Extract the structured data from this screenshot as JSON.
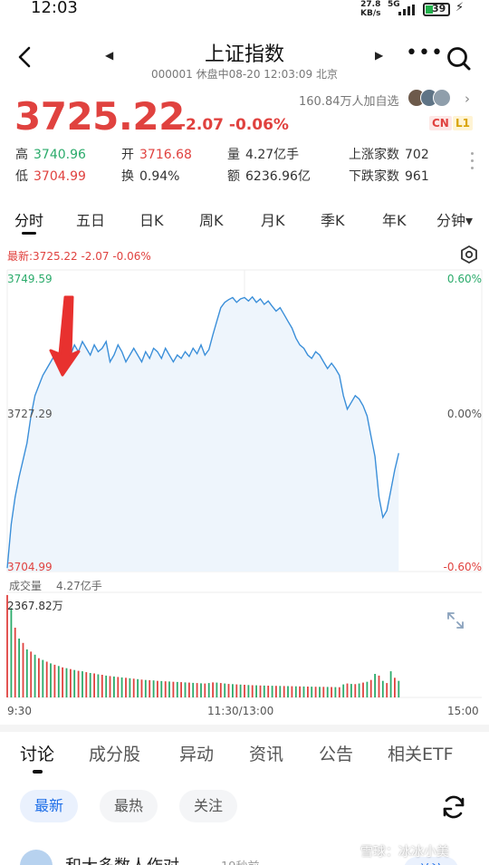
{
  "status_bar": {
    "time": "12:03",
    "net_speed": "27.8",
    "net_unit": "KB/s",
    "signal": "5G",
    "battery": "39"
  },
  "header": {
    "title": "上证指数",
    "subtitle": "000001 休盘中08-20 12:03:09 北京"
  },
  "quote": {
    "price": "3725.22",
    "change": "-2.07 -0.06%",
    "watchers": "160.84万人加自选",
    "tag_cn": "CN",
    "tag_l1": "L1",
    "stats": {
      "high_label": "高",
      "high": "3740.96",
      "open_label": "开",
      "open": "3716.68",
      "vol_label": "量",
      "vol": "4.27亿手",
      "rise_label": "上涨家数",
      "rise": "702",
      "low_label": "低",
      "low": "3704.99",
      "turn_label": "换",
      "turn": "0.94%",
      "amt_label": "额",
      "amt": "6236.96亿",
      "fall_label": "下跌家数",
      "fall": "961"
    }
  },
  "period_tabs": [
    "分时",
    "五日",
    "日K",
    "周K",
    "月K",
    "季K",
    "年K",
    "分钟▾"
  ],
  "chart_header": {
    "latest": "最新:3725.22  -2.07  -0.06%"
  },
  "chart_data": {
    "type": "line",
    "price_axis": {
      "max": "3749.59",
      "mid": "3727.29",
      "min": "3704.99"
    },
    "pct_axis": {
      "max": "0.60%",
      "mid": "0.00%",
      "min": "-0.60%"
    },
    "ylim": [
      3704.99,
      3749.59
    ],
    "prev_close": 3727.29,
    "x_range_minutes": 240,
    "price_series": [
      [
        0,
        3705.5
      ],
      [
        2,
        3712
      ],
      [
        4,
        3716
      ],
      [
        6,
        3719
      ],
      [
        8,
        3721.5
      ],
      [
        10,
        3724
      ],
      [
        12,
        3728
      ],
      [
        14,
        3731
      ],
      [
        16,
        3732.5
      ],
      [
        18,
        3734
      ],
      [
        20,
        3735
      ],
      [
        22,
        3736
      ],
      [
        24,
        3737
      ],
      [
        26,
        3736.5
      ],
      [
        28,
        3737.5
      ],
      [
        30,
        3738
      ],
      [
        32,
        3737
      ],
      [
        34,
        3738.5
      ],
      [
        36,
        3737.5
      ],
      [
        38,
        3739
      ],
      [
        40,
        3738
      ],
      [
        42,
        3737
      ],
      [
        44,
        3738.5
      ],
      [
        46,
        3737.5
      ],
      [
        48,
        3738
      ],
      [
        50,
        3739
      ],
      [
        52,
        3736
      ],
      [
        54,
        3737
      ],
      [
        56,
        3738.5
      ],
      [
        58,
        3737.5
      ],
      [
        60,
        3736
      ],
      [
        62,
        3737
      ],
      [
        64,
        3738
      ],
      [
        66,
        3737
      ],
      [
        68,
        3736
      ],
      [
        70,
        3737.5
      ],
      [
        72,
        3736.5
      ],
      [
        74,
        3738
      ],
      [
        76,
        3737.5
      ],
      [
        78,
        3736.5
      ],
      [
        80,
        3738
      ],
      [
        82,
        3737
      ],
      [
        84,
        3736
      ],
      [
        86,
        3737
      ],
      [
        88,
        3736.5
      ],
      [
        90,
        3737.5
      ],
      [
        92,
        3736.8
      ],
      [
        94,
        3738
      ],
      [
        96,
        3737.2
      ],
      [
        98,
        3738.5
      ],
      [
        100,
        3737
      ],
      [
        102,
        3737.8
      ],
      [
        104,
        3740
      ],
      [
        106,
        3742
      ],
      [
        108,
        3744
      ],
      [
        110,
        3744.8
      ],
      [
        112,
        3745.2
      ],
      [
        114,
        3745.5
      ],
      [
        116,
        3744.8
      ],
      [
        118,
        3745.3
      ],
      [
        120,
        3745.5
      ],
      [
        122,
        3745
      ],
      [
        124,
        3745.6
      ],
      [
        126,
        3744.8
      ],
      [
        128,
        3745.3
      ],
      [
        130,
        3744.5
      ],
      [
        132,
        3745
      ],
      [
        134,
        3744.2
      ],
      [
        136,
        3743.5
      ],
      [
        138,
        3744
      ],
      [
        140,
        3743
      ],
      [
        142,
        3742
      ],
      [
        144,
        3741
      ],
      [
        146,
        3739.5
      ],
      [
        148,
        3738.5
      ],
      [
        150,
        3738
      ],
      [
        152,
        3737
      ],
      [
        154,
        3736.5
      ],
      [
        156,
        3737.5
      ],
      [
        158,
        3737
      ],
      [
        160,
        3736
      ],
      [
        162,
        3735
      ],
      [
        164,
        3735.8
      ],
      [
        166,
        3735
      ],
      [
        168,
        3734
      ],
      [
        170,
        3731
      ],
      [
        172,
        3729
      ],
      [
        174,
        3730
      ],
      [
        176,
        3731
      ],
      [
        178,
        3730.5
      ],
      [
        180,
        3729.5
      ],
      [
        182,
        3728
      ],
      [
        184,
        3725
      ],
      [
        186,
        3722
      ],
      [
        188,
        3716
      ],
      [
        190,
        3713
      ],
      [
        192,
        3714
      ],
      [
        194,
        3717
      ],
      [
        196,
        3720
      ],
      [
        198,
        3722.5
      ]
    ],
    "volume_axis": {
      "label": "成交量",
      "total": "4.27亿手",
      "max_label": "2367.82万"
    },
    "volume_max": 2367.82,
    "volume_colors": {
      "up": "#e0423f",
      "down": "#2bab6b"
    },
    "volume_series": [
      [
        0,
        2350,
        "r"
      ],
      [
        2,
        2050,
        "g"
      ],
      [
        4,
        1600,
        "r"
      ],
      [
        6,
        1350,
        "g"
      ],
      [
        8,
        1250,
        "r"
      ],
      [
        10,
        1100,
        "g"
      ],
      [
        12,
        1050,
        "r"
      ],
      [
        14,
        980,
        "g"
      ],
      [
        16,
        900,
        "r"
      ],
      [
        18,
        860,
        "g"
      ],
      [
        20,
        820,
        "r"
      ],
      [
        22,
        780,
        "g"
      ],
      [
        24,
        750,
        "r"
      ],
      [
        26,
        720,
        "g"
      ],
      [
        28,
        690,
        "r"
      ],
      [
        30,
        670,
        "g"
      ],
      [
        32,
        650,
        "r"
      ],
      [
        34,
        630,
        "g"
      ],
      [
        36,
        610,
        "r"
      ],
      [
        38,
        600,
        "g"
      ],
      [
        40,
        580,
        "r"
      ],
      [
        42,
        560,
        "g"
      ],
      [
        44,
        550,
        "r"
      ],
      [
        46,
        530,
        "g"
      ],
      [
        48,
        520,
        "r"
      ],
      [
        50,
        500,
        "g"
      ],
      [
        52,
        490,
        "r"
      ],
      [
        54,
        480,
        "g"
      ],
      [
        56,
        470,
        "r"
      ],
      [
        58,
        460,
        "g"
      ],
      [
        60,
        450,
        "r"
      ],
      [
        62,
        440,
        "g"
      ],
      [
        64,
        430,
        "r"
      ],
      [
        66,
        420,
        "g"
      ],
      [
        68,
        410,
        "r"
      ],
      [
        70,
        400,
        "g"
      ],
      [
        72,
        395,
        "r"
      ],
      [
        74,
        390,
        "g"
      ],
      [
        76,
        380,
        "r"
      ],
      [
        78,
        375,
        "g"
      ],
      [
        80,
        370,
        "r"
      ],
      [
        82,
        365,
        "g"
      ],
      [
        84,
        360,
        "r"
      ],
      [
        86,
        355,
        "g"
      ],
      [
        88,
        350,
        "r"
      ],
      [
        90,
        345,
        "g"
      ],
      [
        92,
        340,
        "r"
      ],
      [
        94,
        335,
        "g"
      ],
      [
        96,
        330,
        "r"
      ],
      [
        98,
        325,
        "g"
      ],
      [
        100,
        320,
        "r"
      ],
      [
        102,
        330,
        "g"
      ],
      [
        104,
        345,
        "r"
      ],
      [
        106,
        340,
        "g"
      ],
      [
        108,
        330,
        "r"
      ],
      [
        110,
        320,
        "g"
      ],
      [
        112,
        310,
        "r"
      ],
      [
        114,
        305,
        "g"
      ],
      [
        116,
        300,
        "r"
      ],
      [
        118,
        295,
        "g"
      ],
      [
        120,
        290,
        "r"
      ],
      [
        122,
        285,
        "g"
      ],
      [
        124,
        280,
        "r"
      ],
      [
        126,
        278,
        "g"
      ],
      [
        128,
        275,
        "r"
      ],
      [
        130,
        272,
        "g"
      ],
      [
        132,
        270,
        "r"
      ],
      [
        134,
        268,
        "g"
      ],
      [
        136,
        266,
        "r"
      ],
      [
        138,
        264,
        "g"
      ],
      [
        140,
        262,
        "r"
      ],
      [
        142,
        260,
        "g"
      ],
      [
        144,
        258,
        "r"
      ],
      [
        146,
        256,
        "g"
      ],
      [
        148,
        254,
        "r"
      ],
      [
        150,
        252,
        "g"
      ],
      [
        152,
        250,
        "r"
      ],
      [
        154,
        248,
        "g"
      ],
      [
        156,
        246,
        "r"
      ],
      [
        158,
        244,
        "g"
      ],
      [
        160,
        242,
        "r"
      ],
      [
        162,
        240,
        "g"
      ],
      [
        164,
        238,
        "r"
      ],
      [
        166,
        236,
        "g"
      ],
      [
        168,
        234,
        "r"
      ],
      [
        170,
        300,
        "g"
      ],
      [
        172,
        320,
        "r"
      ],
      [
        174,
        310,
        "g"
      ],
      [
        176,
        305,
        "r"
      ],
      [
        178,
        320,
        "g"
      ],
      [
        180,
        340,
        "r"
      ],
      [
        182,
        360,
        "g"
      ],
      [
        184,
        400,
        "r"
      ],
      [
        186,
        540,
        "g"
      ],
      [
        188,
        500,
        "r"
      ],
      [
        190,
        380,
        "g"
      ],
      [
        192,
        330,
        "r"
      ],
      [
        194,
        600,
        "g"
      ],
      [
        196,
        450,
        "r"
      ],
      [
        198,
        380,
        "g"
      ]
    ],
    "time_axis": {
      "start": "9:30",
      "mid": "11:30/13:00",
      "end": "15:00"
    }
  },
  "bottom_tabs": [
    "讨论",
    "成分股",
    "异动",
    "资讯",
    "公告",
    "相关ETF"
  ],
  "filter_chips": [
    "最新",
    "最热",
    "关注"
  ],
  "post": {
    "author": "和大多数人作对",
    "ago": "19秒前",
    "follow": "关注"
  },
  "watermark": "雪球：冰冰小美",
  "colors": {
    "up": "#e0423f",
    "down": "#2bab6b",
    "line": "#3b8fd9",
    "accent": "#1d6ee8",
    "arrow": "#e8312f"
  },
  "icons": [
    "back-arrow-icon",
    "prev-icon",
    "next-icon",
    "more-icon",
    "search-icon",
    "settings-icon",
    "expand-icon",
    "refresh-icon",
    "red-arrow-annotation"
  ]
}
